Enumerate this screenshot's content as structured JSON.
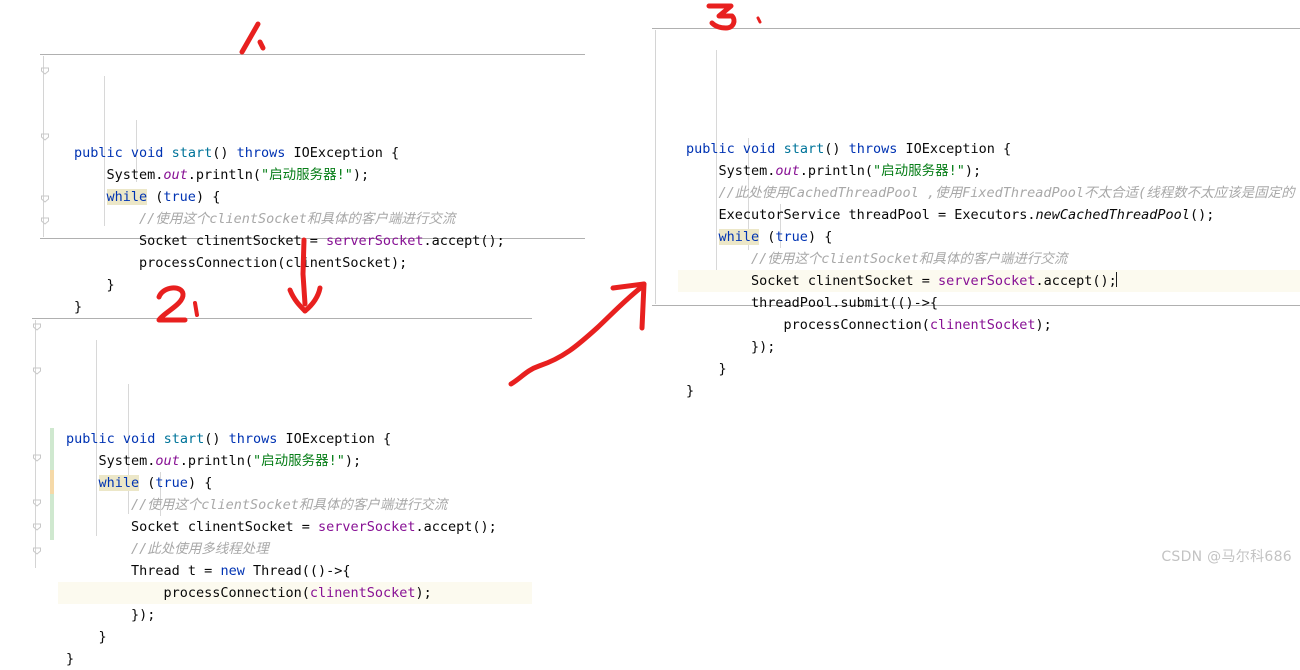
{
  "page": {
    "watermark": "CSDN @马尔科686",
    "accent_red": "#e8201f",
    "keyword_color": "#0033b3",
    "string_color": "#067d17",
    "field_color": "#871094",
    "comment_color": "#a8a8a8",
    "method_color": "#00749a",
    "caret_line_bg": "#fcfaef",
    "keyword_highlight_bg": "#ece7c8"
  },
  "blocks": [
    {
      "id": "code-block-1",
      "step_label": "1、",
      "lines": [
        [
          {
            "t": "public",
            "c": "k"
          },
          {
            "t": " ",
            "c": "pl"
          },
          {
            "t": "void",
            "c": "k"
          },
          {
            "t": " ",
            "c": "pl"
          },
          {
            "t": "start",
            "c": "fn"
          },
          {
            "t": "() ",
            "c": "pl"
          },
          {
            "t": "throws",
            "c": "k"
          },
          {
            "t": " IOException {",
            "c": "pl"
          }
        ],
        [
          {
            "t": "    System.",
            "c": "pl"
          },
          {
            "t": "out",
            "c": "fldi"
          },
          {
            "t": ".println(",
            "c": "pl"
          },
          {
            "t": "\"启动服务器!\"",
            "c": "str"
          },
          {
            "t": ");",
            "c": "pl"
          }
        ],
        [
          {
            "t": "    ",
            "c": "pl"
          },
          {
            "t": "while",
            "c": "k-hl"
          },
          {
            "t": " (",
            "c": "pl"
          },
          {
            "t": "true",
            "c": "k"
          },
          {
            "t": ") {",
            "c": "pl"
          }
        ],
        [
          {
            "t": "        ",
            "c": "pl"
          },
          {
            "t": "//使用这个clientSocket和具体的客户端进行交流",
            "c": "cm"
          }
        ],
        [
          {
            "t": "        Socket clinentSocket = ",
            "c": "pl"
          },
          {
            "t": "serverSocket",
            "c": "fld"
          },
          {
            "t": ".accept();",
            "c": "pl"
          }
        ],
        [
          {
            "t": "        processConnection(clinentSocket);",
            "c": "pl"
          }
        ],
        [
          {
            "t": "    }",
            "c": "pl"
          }
        ],
        [
          {
            "t": "}",
            "c": "pl"
          }
        ]
      ]
    },
    {
      "id": "code-block-2",
      "step_label": "2、",
      "lines": [
        [
          {
            "t": "public",
            "c": "k"
          },
          {
            "t": " ",
            "c": "pl"
          },
          {
            "t": "void",
            "c": "k"
          },
          {
            "t": " ",
            "c": "pl"
          },
          {
            "t": "start",
            "c": "fn"
          },
          {
            "t": "() ",
            "c": "pl"
          },
          {
            "t": "throws",
            "c": "k"
          },
          {
            "t": " IOException {",
            "c": "pl"
          }
        ],
        [
          {
            "t": "    System.",
            "c": "pl"
          },
          {
            "t": "out",
            "c": "fldi"
          },
          {
            "t": ".println(",
            "c": "pl"
          },
          {
            "t": "\"启动服务器!\"",
            "c": "str"
          },
          {
            "t": ");",
            "c": "pl"
          }
        ],
        [
          {
            "t": "    ",
            "c": "pl"
          },
          {
            "t": "while",
            "c": "k-hl"
          },
          {
            "t": " (",
            "c": "pl"
          },
          {
            "t": "true",
            "c": "k"
          },
          {
            "t": ") {",
            "c": "pl"
          }
        ],
        [
          {
            "t": "        ",
            "c": "pl"
          },
          {
            "t": "//使用这个clientSocket和具体的客户端进行交流",
            "c": "cm"
          }
        ],
        [
          {
            "t": "        Socket clinentSocket = ",
            "c": "pl"
          },
          {
            "t": "serverSocket",
            "c": "fld"
          },
          {
            "t": ".accept();",
            "c": "pl"
          }
        ],
        [
          {
            "t": "        ",
            "c": "pl"
          },
          {
            "t": "//此处使用多线程处理",
            "c": "cm"
          }
        ],
        [
          {
            "t": "        Thread t = ",
            "c": "pl"
          },
          {
            "t": "new",
            "c": "k"
          },
          {
            "t": " Thread(()->{",
            "c": "pl"
          }
        ],
        [
          {
            "t": "            processConnection(",
            "c": "pl"
          },
          {
            "t": "clinentSocket",
            "c": "fld"
          },
          {
            "t": ");",
            "c": "pl"
          }
        ],
        [
          {
            "t": "        });",
            "c": "pl"
          }
        ],
        [
          {
            "t": "    }",
            "c": "pl"
          }
        ],
        [
          {
            "t": "}",
            "c": "pl"
          }
        ]
      ]
    },
    {
      "id": "code-block-3",
      "step_label": "3、",
      "lines": [
        [
          {
            "t": "public",
            "c": "k"
          },
          {
            "t": " ",
            "c": "pl"
          },
          {
            "t": "void",
            "c": "k"
          },
          {
            "t": " ",
            "c": "pl"
          },
          {
            "t": "start",
            "c": "fn"
          },
          {
            "t": "() ",
            "c": "pl"
          },
          {
            "t": "throws",
            "c": "k"
          },
          {
            "t": " IOException {",
            "c": "pl"
          }
        ],
        [
          {
            "t": "    System.",
            "c": "pl"
          },
          {
            "t": "out",
            "c": "fldi"
          },
          {
            "t": ".println(",
            "c": "pl"
          },
          {
            "t": "\"启动服务器!\"",
            "c": "str"
          },
          {
            "t": ");",
            "c": "pl"
          }
        ],
        [
          {
            "t": "    ",
            "c": "pl"
          },
          {
            "t": "//此处使用CachedThreadPool ,使用FixedThreadPool不太合适(线程数不太应该是固定的 )",
            "c": "cm"
          }
        ],
        [
          {
            "t": "    ExecutorService threadPool = Executors.",
            "c": "pl"
          },
          {
            "t": "newCachedThreadPool",
            "c": "mi"
          },
          {
            "t": "();",
            "c": "pl"
          }
        ],
        [
          {
            "t": "    ",
            "c": "pl"
          },
          {
            "t": "while",
            "c": "k-hl"
          },
          {
            "t": " (",
            "c": "pl"
          },
          {
            "t": "true",
            "c": "k"
          },
          {
            "t": ") {",
            "c": "pl"
          }
        ],
        [
          {
            "t": "        ",
            "c": "pl"
          },
          {
            "t": "//使用这个clientSocket和具体的客户端进行交流",
            "c": "cm"
          }
        ],
        [
          {
            "t": "        Socket clinentSocket = ",
            "c": "pl"
          },
          {
            "t": "serverSocket",
            "c": "fld"
          },
          {
            "t": ".accept();",
            "c": "pl"
          }
        ],
        [
          {
            "t": "        threadPool.submit(()->{",
            "c": "pl"
          }
        ],
        [
          {
            "t": "            processConnection(",
            "c": "pl"
          },
          {
            "t": "clinentSocket",
            "c": "fld"
          },
          {
            "t": ");",
            "c": "pl"
          }
        ],
        [
          {
            "t": "        });",
            "c": "pl"
          }
        ],
        [
          {
            "t": "    }",
            "c": "pl"
          }
        ],
        [
          {
            "t": "}",
            "c": "pl"
          }
        ]
      ]
    }
  ],
  "annotations": {
    "step1_label": "1、",
    "step2_label": "2、",
    "step3_label": "3、",
    "arrow_down": "arrow-down-1-to-2",
    "arrow_diagonal": "arrow-up-right-2-to-3"
  }
}
